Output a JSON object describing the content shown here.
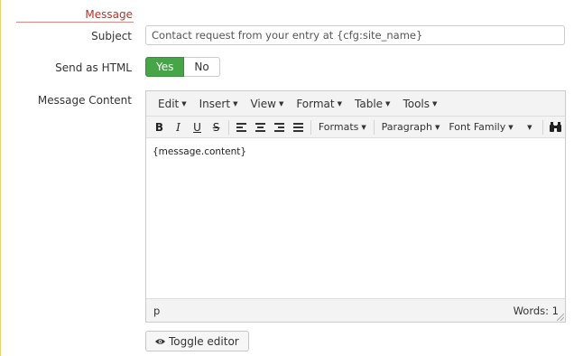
{
  "section": {
    "title": "Message"
  },
  "subject": {
    "label": "Subject",
    "value": "Contact request from your entry at {cfg:site_name}"
  },
  "send_html": {
    "label": "Send as HTML",
    "yes": "Yes",
    "no": "No",
    "selected": "Yes"
  },
  "message_content": {
    "label": "Message Content"
  },
  "editor": {
    "menus": [
      "Edit",
      "Insert",
      "View",
      "Format",
      "Table",
      "Tools"
    ],
    "toolbar": {
      "bold": "B",
      "italic": "I",
      "underline": "U",
      "strikethrough": "S",
      "formats": "Formats",
      "paragraph": "Paragraph",
      "font_family": "Font Family"
    },
    "content": "{message.content}",
    "status_path": "p",
    "word_count": "Words: 1"
  },
  "toggle_editor": {
    "label": "Toggle editor"
  },
  "colors": {
    "yes_active": "#46a546",
    "section_title": "#b8322c"
  }
}
